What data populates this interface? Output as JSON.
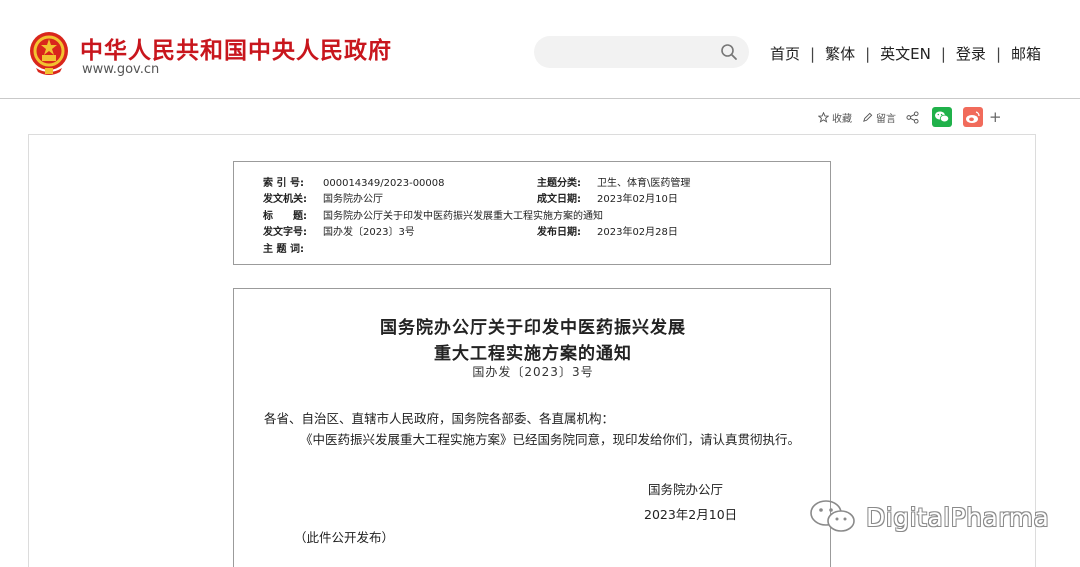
{
  "header": {
    "site_title": "中华人民共和国中央人民政府",
    "domain": "www.gov.cn",
    "search": {
      "placeholder": "",
      "value": ""
    },
    "nav": [
      {
        "label": "首页"
      },
      {
        "label": "繁体"
      },
      {
        "label": "英文EN"
      },
      {
        "label": "登录"
      },
      {
        "label": "邮箱"
      }
    ],
    "nav_separator": "|"
  },
  "toolbar": {
    "favorite_label": "收藏",
    "comment_label": "留言",
    "plus_label": "+"
  },
  "meta": {
    "index_label": "索 引 号:",
    "index_value": "000014349/2023-00008",
    "category_label": "主题分类:",
    "category_value": "卫生、体育\\医药管理",
    "issuer_label": "发文机关:",
    "issuer_value": "国务院办公厅",
    "written_label": "成文日期:",
    "written_value": "2023年02月10日",
    "title_label": "标　　题:",
    "title_value": "国务院办公厅关于印发中医药振兴发展重大工程实施方案的通知",
    "docno_label": "发文字号:",
    "docno_value": "国办发〔2023〕3号",
    "published_label": "发布日期:",
    "published_value": "2023年02月28日",
    "keywords_label": "主 题 词:",
    "keywords_value": ""
  },
  "document": {
    "title_line1": "国务院办公厅关于印发中医药振兴发展",
    "title_line2": "重大工程实施方案的通知",
    "doc_number": "国办发〔2023〕3号",
    "salutation": "各省、自治区、直辖市人民政府，国务院各部委、各直属机构：",
    "body": "《中医药振兴发展重大工程实施方案》已经国务院同意，现印发给你们，请认真贯彻执行。",
    "signature": "国务院办公厅",
    "date": "2023年2月10日",
    "note": "（此件公开发布）"
  },
  "watermark": {
    "text": "DigitalPharma"
  },
  "colors": {
    "brand_red": "#c8161d",
    "wechat_green": "#20b14a",
    "weibo_red": "#f16b5b",
    "border_gray": "#9b9b9b"
  },
  "icons": [
    "national-emblem-icon",
    "search-icon",
    "star-icon",
    "pencil-icon",
    "share-icon",
    "wechat-icon",
    "weibo-icon",
    "plus-icon",
    "wechat-logo-icon"
  ]
}
